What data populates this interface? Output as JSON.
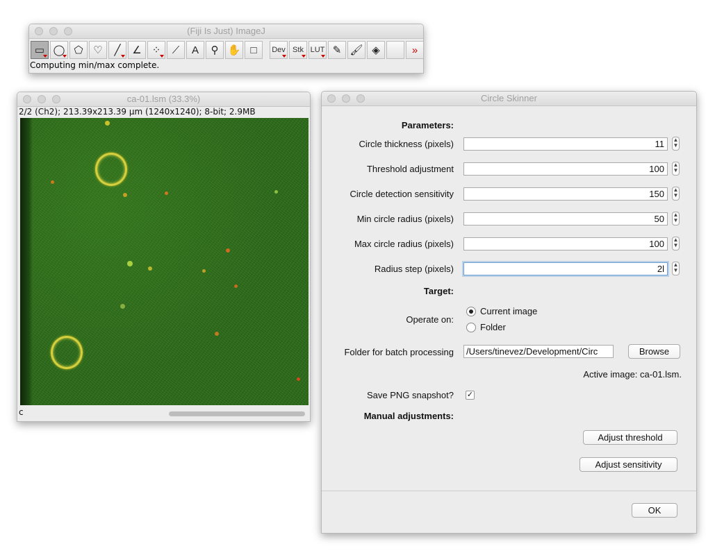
{
  "imagej": {
    "title": "(Fiji Is Just) ImageJ",
    "status": "Computing min/max complete.",
    "tools": [
      {
        "name": "rectangle-tool-icon",
        "glyph": "▭",
        "active": true,
        "menu": true
      },
      {
        "name": "oval-tool-icon",
        "glyph": "◯",
        "menu": true
      },
      {
        "name": "polygon-tool-icon",
        "glyph": "⬠"
      },
      {
        "name": "freehand-tool-icon",
        "glyph": "♡"
      },
      {
        "name": "line-tool-icon",
        "glyph": "╱",
        "menu": true
      },
      {
        "name": "angle-tool-icon",
        "glyph": "∠"
      },
      {
        "name": "point-tool-icon",
        "glyph": "⁘",
        "menu": true
      },
      {
        "name": "wand-tool-icon",
        "glyph": "⟋"
      },
      {
        "name": "text-tool-icon",
        "glyph": "A"
      },
      {
        "name": "zoom-tool-icon",
        "glyph": "⚲"
      },
      {
        "name": "hand-tool-icon",
        "glyph": "✋"
      },
      {
        "name": "color-picker-icon",
        "glyph": "□"
      },
      {
        "name": "dev-menu-button",
        "glyph": "Dev",
        "menu": true,
        "text": true,
        "gap": true
      },
      {
        "name": "stk-menu-button",
        "glyph": "Stk",
        "menu": true,
        "text": true
      },
      {
        "name": "lut-menu-button",
        "glyph": "LUT",
        "menu": true,
        "text": true
      },
      {
        "name": "pencil-tool-icon",
        "glyph": "✎"
      },
      {
        "name": "brush-tool-icon",
        "glyph": "🖌"
      },
      {
        "name": "flood-fill-icon",
        "glyph": "◈"
      },
      {
        "name": "blank-tool-slot",
        "glyph": ""
      },
      {
        "name": "more-tools-icon",
        "glyph": "»",
        "red": true
      }
    ]
  },
  "image_window": {
    "title": "ca-01.lsm (33.3%)",
    "info": "2/2 (Ch2); 213.39x213.39 µm (1240x1240); 8-bit; 2.9MB",
    "channel_label": "c"
  },
  "dialog": {
    "title": "Circle Skinner",
    "parameters_heading": "Parameters:",
    "fields": [
      {
        "label": "Circle thickness (pixels)",
        "value": "11"
      },
      {
        "label": "Threshold adjustment",
        "value": "100"
      },
      {
        "label": "Circle detection sensitivity",
        "value": "150"
      },
      {
        "label": "Min circle radius (pixels)",
        "value": "50"
      },
      {
        "label": "Max circle radius (pixels)",
        "value": "100"
      },
      {
        "label": "Radius step (pixels)",
        "value": "2l"
      }
    ],
    "target_heading": "Target:",
    "operate_on_label": "Operate on:",
    "option_current": "Current image",
    "option_folder": "Folder",
    "folder_label": "Folder for batch processing",
    "folder_value": "/Users/tinevez/Development/Circ",
    "browse_label": "Browse",
    "active_image": "Active image: ca-01.lsm.",
    "save_png_label": "Save PNG snapshot?",
    "save_png_checked": true,
    "manual_heading": "Manual adjustments:",
    "adjust_threshold_label": "Adjust threshold",
    "adjust_sensitivity_label": "Adjust sensitivity",
    "ok_label": "OK"
  }
}
